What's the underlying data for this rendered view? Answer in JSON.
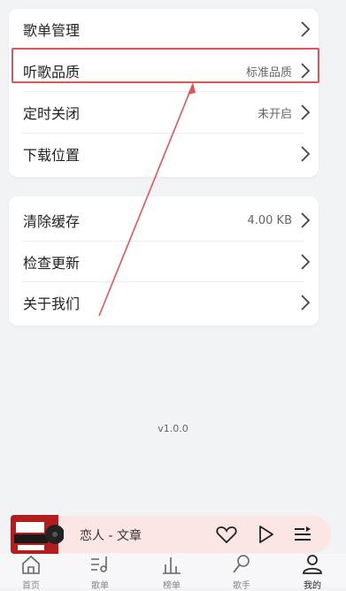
{
  "settings_group_1": {
    "items": [
      {
        "label": "歌单管理",
        "value": ""
      },
      {
        "label": "听歌品质",
        "value": "标准品质"
      },
      {
        "label": "定时关闭",
        "value": "未开启"
      },
      {
        "label": "下载位置",
        "value": ""
      }
    ]
  },
  "settings_group_2": {
    "items": [
      {
        "label": "清除缓存",
        "value": "4.00 KB"
      },
      {
        "label": "检查更新",
        "value": ""
      },
      {
        "label": "关于我们",
        "value": ""
      }
    ]
  },
  "version": "v1.0.0",
  "player": {
    "song": "恋人 - 文章",
    "cover_icon": "album-cover",
    "accent": "#fbe6e4"
  },
  "tabbar": {
    "tabs": [
      {
        "label": "首页",
        "icon": "home-icon"
      },
      {
        "label": "歌单",
        "icon": "playlist-icon"
      },
      {
        "label": "榜单",
        "icon": "chart-icon"
      },
      {
        "label": "歌手",
        "icon": "microphone-icon"
      },
      {
        "label": "我的",
        "icon": "user-icon",
        "active": true
      }
    ]
  },
  "annotation_color": "#e0555a"
}
